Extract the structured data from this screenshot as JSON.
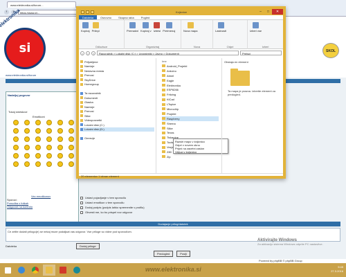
{
  "browser": {
    "tab_title": "www.elektronika.si/forum...",
    "url": "https://www.el..."
  },
  "site": {
    "logo_text": "si",
    "logo_ring": "elektronika",
    "logo_url": "www.elektronika.si/forum",
    "badge": "SKOL",
    "bar1": "",
    "panel_title": "Nadaljuj pogovor",
    "panel_label": "Tukaj smeskovi",
    "emoji_header": "Emotikoni",
    "more_emoji": "Vec emotikonov",
    "side_labels": [
      "Sporoci:",
      "Ponudba v fotkah",
      "Odgovori na kontrolo"
    ],
    "options": [
      "Ustavi pojavljanje v tem sporocilu",
      "Ustavi emotikon v tem sporocilu",
      "Dodaj podpis (podpis lahko spremenite v profilu)",
      "Obvesti me, ko bo prispel nov odgovor"
    ],
    "info_bar": "Dodajanje prilog/datotek",
    "info_text": "Ce zelite dodati prilogo(e) se nekaj moze podaljsat vas odgovor. Vse priloge so vidne pod sporocilom.",
    "attach_label": "Datoteka",
    "attach_button": "Dodaj priloge",
    "submit_button": "Predogled",
    "send_button": "Poslji",
    "footer_text": "Povered by phpBB © phpBB Group",
    "watermark_line1": "Aktivirajte Windows",
    "watermark_line2": "Za aktivacijo sistema Windows odprite PC nastavitve."
  },
  "explorer": {
    "title": "Knjiznice",
    "ribbon_tabs": [
      "Datoteka",
      "Osnovno",
      "Skupna raba",
      "Pogled"
    ],
    "ribbon_groups": [
      {
        "label": "Odlozisce",
        "items": [
          "Kopiraj",
          "Prilepi"
        ]
      },
      {
        "label": "Organiziraj",
        "items": [
          "Premakni",
          "Kopiraj v",
          "Izbrisi",
          "Preimenuj"
        ]
      },
      {
        "label": "Nova",
        "items": [
          "Nova mapa"
        ]
      },
      {
        "label": "Odpri",
        "items": [
          "Lastnosti"
        ]
      },
      {
        "label": "Izberi",
        "items": [
          "Izberi vse"
        ]
      }
    ],
    "address": "Racunalnik > Lokalni disk (C:) > Uporabniki > Javno > Dokumenti",
    "search_placeholder": "Preisci",
    "nav_pane": [
      {
        "label": "Priljubljene",
        "icon": "star-icon"
      },
      {
        "label": "Namizje",
        "icon": "folder-icon"
      },
      {
        "label": "Nedavna mesta",
        "icon": "folder-icon"
      },
      {
        "label": "Prenosi",
        "icon": "folder-icon"
      },
      {
        "label": "SkyDrive",
        "icon": "folder-icon"
      },
      {
        "label": "Homegroup",
        "icon": "folder-icon"
      },
      {
        "label": "",
        "icon": ""
      },
      {
        "label": "Ta racunalnik",
        "icon": "computer-icon"
      },
      {
        "label": "Dokumenti",
        "icon": "folder-icon"
      },
      {
        "label": "Glasba",
        "icon": "folder-icon"
      },
      {
        "label": "Namizje",
        "icon": "folder-icon"
      },
      {
        "label": "Prenosi",
        "icon": "folder-icon"
      },
      {
        "label": "Slike",
        "icon": "folder-icon"
      },
      {
        "label": "Videoposnetki",
        "icon": "folder-icon"
      },
      {
        "label": "Lokalni disk (C:)",
        "icon": "drive-icon"
      },
      {
        "label": "Lokalni disk (D:)",
        "icon": "drive-icon"
      },
      {
        "label": "",
        "icon": ""
      },
      {
        "label": "Omrezje",
        "icon": "network-icon"
      }
    ],
    "file_header": "Ime",
    "files": [
      "Android_Projekti",
      "Arduino",
      "Atmel",
      "Eagle",
      "Elektronika",
      "ESP8266",
      "Fritzing",
      "KiCad",
      "LTspice",
      "Microchip",
      "Projekti",
      "Raspberry",
      "Shema",
      "Slike",
      "Texas",
      "Tiskanine",
      "Tools",
      "Vezja",
      "Z80",
      "Zip"
    ],
    "selected_file_index": 11,
    "context_menu": [
      "Razsiri mapo v knjiznico",
      "Odpri v novem oknu",
      "Pripni na zacetni zaslon",
      "Vkljuci v knjiznico"
    ],
    "preview_title": "Obstaja en element",
    "preview_caption": "Ta mapa je prazna. Izberite element za predogled.",
    "status": "20 elementov    1 izbran element"
  },
  "taskbar": {
    "watermark": "www.elektronika.si",
    "time": "9:45",
    "date": "27.3.2016"
  },
  "colors": {
    "accent_blue": "#2f6ea6",
    "window_frame": "#e2b33a",
    "logo_red": "#e51c1c"
  }
}
